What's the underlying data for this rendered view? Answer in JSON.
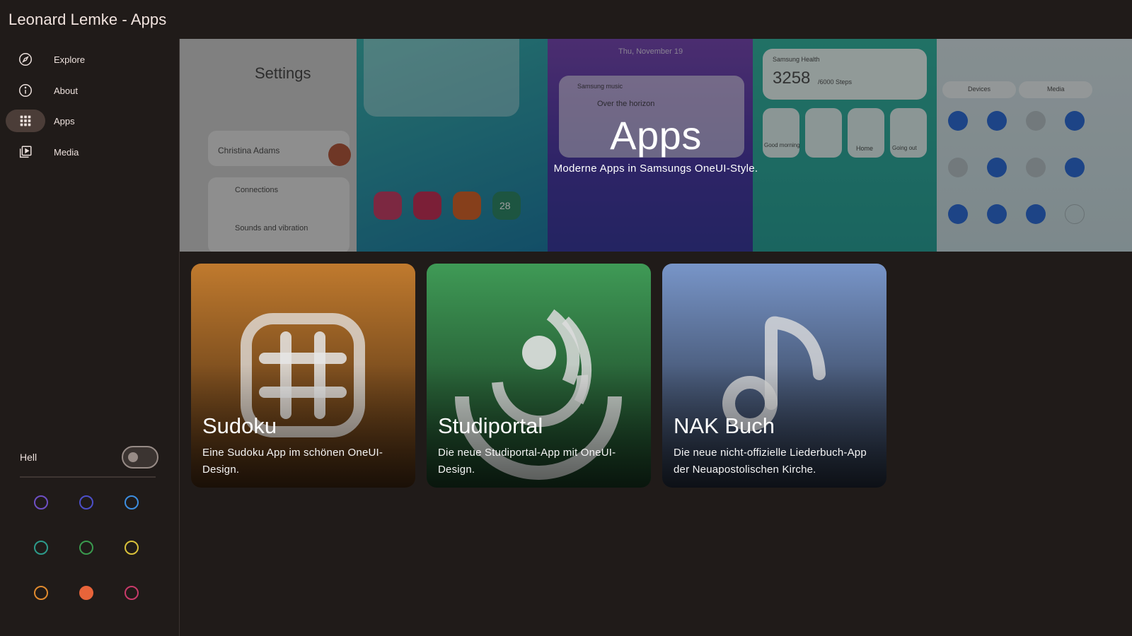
{
  "app": {
    "title": "Leonard Lemke - Apps"
  },
  "sidebar": {
    "items": [
      {
        "label": "Explore",
        "icon": "compass-icon"
      },
      {
        "label": "About",
        "icon": "info-icon"
      },
      {
        "label": "Apps",
        "icon": "apps-grid-icon",
        "active": true
      },
      {
        "label": "Media",
        "icon": "video-library-icon"
      }
    ],
    "theme_label": "Hell",
    "theme_toggle_on": false,
    "swatches": [
      {
        "name": "purple",
        "color": "#6e4fc4",
        "selected": false
      },
      {
        "name": "indigo",
        "color": "#4c4fc9",
        "selected": false
      },
      {
        "name": "blue",
        "color": "#3d8ee0",
        "selected": false
      },
      {
        "name": "teal",
        "color": "#2d9a8a",
        "selected": false
      },
      {
        "name": "green",
        "color": "#3a9a4e",
        "selected": false
      },
      {
        "name": "yellow",
        "color": "#d9c13a",
        "selected": false
      },
      {
        "name": "orange",
        "color": "#e08a2e",
        "selected": false
      },
      {
        "name": "deep-orange",
        "color": "#e8643a",
        "selected": true
      },
      {
        "name": "pink",
        "color": "#c93a6a",
        "selected": false
      }
    ]
  },
  "hero": {
    "title": "Apps",
    "subtitle": "Moderne Apps in Samsungs OneUI-Style.",
    "background_texts": {
      "settings": "Settings",
      "profile_name": "Christina Adams",
      "connections": "Connections",
      "sounds": "Sounds and vibration",
      "date": "Thu, November 19",
      "music_app": "Samsung music",
      "song": "Over the horizon",
      "health": "Samsung Health",
      "steps": "3258",
      "steps_goal": "/6000 Steps",
      "home": "Home",
      "going_out": "Going out",
      "good_morning": "Good morning",
      "devices": "Devices",
      "media": "Media",
      "calendar_day": "28"
    }
  },
  "cards": [
    {
      "title": "Sudoku",
      "description": "Eine Sudoku App im schönen OneUI-Design.",
      "icon": "hashtag-icon",
      "color_top": "#c07a2e",
      "color_bottom": "#3a230f"
    },
    {
      "title": "Studiportal",
      "description": "Die neue Studiportal-App mit OneUI-Design.",
      "icon": "studiportal-logo-icon",
      "color_top": "#3f9a56",
      "color_bottom": "#14301c"
    },
    {
      "title": "NAK Buch",
      "description": "Die neue nicht-offizielle Liederbuch-App der Neuapostolischen Kirche.",
      "icon": "music-note-icon",
      "color_top": "#7895c8",
      "color_bottom": "#1d2431"
    }
  ]
}
